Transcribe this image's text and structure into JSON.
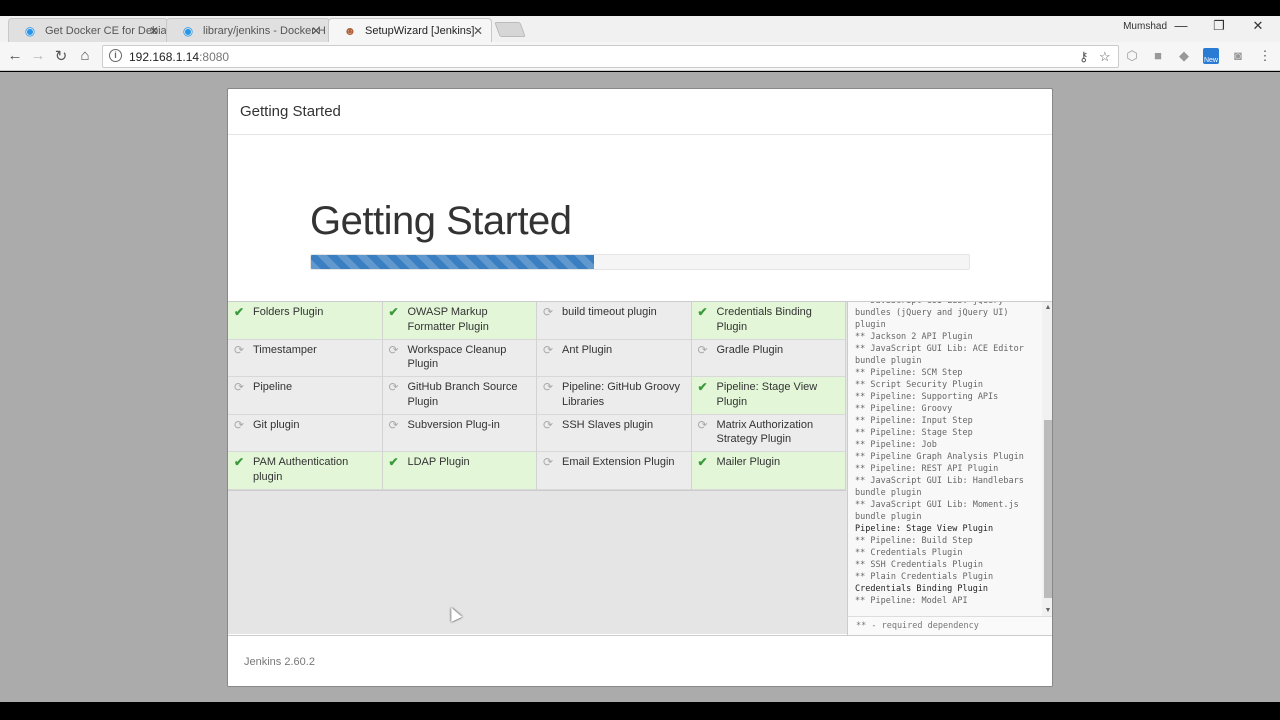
{
  "browser": {
    "tabs": [
      {
        "title": "Get Docker CE for Debia",
        "icon": "docker-icon",
        "close": "✕"
      },
      {
        "title": "library/jenkins - Docker H",
        "icon": "docker-icon",
        "close": "✕"
      },
      {
        "title": "SetupWizard [Jenkins]",
        "icon": "jenkins-icon",
        "close": "✕"
      }
    ],
    "user": "Mumshad",
    "address": {
      "host": "192.168.1.14",
      "port": ":8080"
    }
  },
  "wizard": {
    "header_title": "Getting Started",
    "hero_title": "Getting Started",
    "progress": 0.43,
    "plugins": [
      {
        "name": "Folders Plugin",
        "status": "success"
      },
      {
        "name": "OWASP Markup Formatter Plugin",
        "status": "success"
      },
      {
        "name": "build timeout plugin",
        "status": "pending"
      },
      {
        "name": "Credentials Binding Plugin",
        "status": "success"
      },
      {
        "name": "Timestamper",
        "status": "pending"
      },
      {
        "name": "Workspace Cleanup Plugin",
        "status": "pending"
      },
      {
        "name": "Ant Plugin",
        "status": "pending"
      },
      {
        "name": "Gradle Plugin",
        "status": "pending"
      },
      {
        "name": "Pipeline",
        "status": "pending"
      },
      {
        "name": "GitHub Branch Source Plugin",
        "status": "pending"
      },
      {
        "name": "Pipeline: GitHub Groovy Libraries",
        "status": "pending"
      },
      {
        "name": "Pipeline: Stage View Plugin",
        "status": "success"
      },
      {
        "name": "Git plugin",
        "status": "pending"
      },
      {
        "name": "Subversion Plug-in",
        "status": "pending"
      },
      {
        "name": "SSH Slaves plugin",
        "status": "pending"
      },
      {
        "name": "Matrix Authorization Strategy Plugin",
        "status": "pending"
      },
      {
        "name": "PAM Authentication plugin",
        "status": "success"
      },
      {
        "name": "LDAP Plugin",
        "status": "success"
      },
      {
        "name": "Email Extension Plugin",
        "status": "pending"
      },
      {
        "name": "Mailer Plugin",
        "status": "success"
      }
    ],
    "log_lines": [
      {
        "text": "** JavaScript GUI Lib: jQuery bundles (jQuery and jQuery UI) plugin",
        "highlight": false
      },
      {
        "text": "** Jackson 2 API Plugin",
        "highlight": false
      },
      {
        "text": "** JavaScript GUI Lib: ACE Editor bundle plugin",
        "highlight": false
      },
      {
        "text": "** Pipeline: SCM Step",
        "highlight": false
      },
      {
        "text": "** Script Security Plugin",
        "highlight": false
      },
      {
        "text": "** Pipeline: Supporting APIs",
        "highlight": false
      },
      {
        "text": "** Pipeline: Groovy",
        "highlight": false
      },
      {
        "text": "** Pipeline: Input Step",
        "highlight": false
      },
      {
        "text": "** Pipeline: Stage Step",
        "highlight": false
      },
      {
        "text": "** Pipeline: Job",
        "highlight": false
      },
      {
        "text": "** Pipeline Graph Analysis Plugin",
        "highlight": false
      },
      {
        "text": "** Pipeline: REST API Plugin",
        "highlight": false
      },
      {
        "text": "** JavaScript GUI Lib: Handlebars bundle plugin",
        "highlight": false
      },
      {
        "text": "** JavaScript GUI Lib: Moment.js bundle plugin",
        "highlight": false
      },
      {
        "text": "Pipeline: Stage View Plugin",
        "highlight": true
      },
      {
        "text": "** Pipeline: Build Step",
        "highlight": false
      },
      {
        "text": "** Credentials Plugin",
        "highlight": false
      },
      {
        "text": "** SSH Credentials Plugin",
        "highlight": false
      },
      {
        "text": "** Plain Credentials Plugin",
        "highlight": false
      },
      {
        "text": "Credentials Binding Plugin",
        "highlight": true
      },
      {
        "text": "** Pipeline: Model API",
        "highlight": false
      }
    ],
    "legend": "** - required dependency",
    "footer": "Jenkins 2.60.2"
  }
}
